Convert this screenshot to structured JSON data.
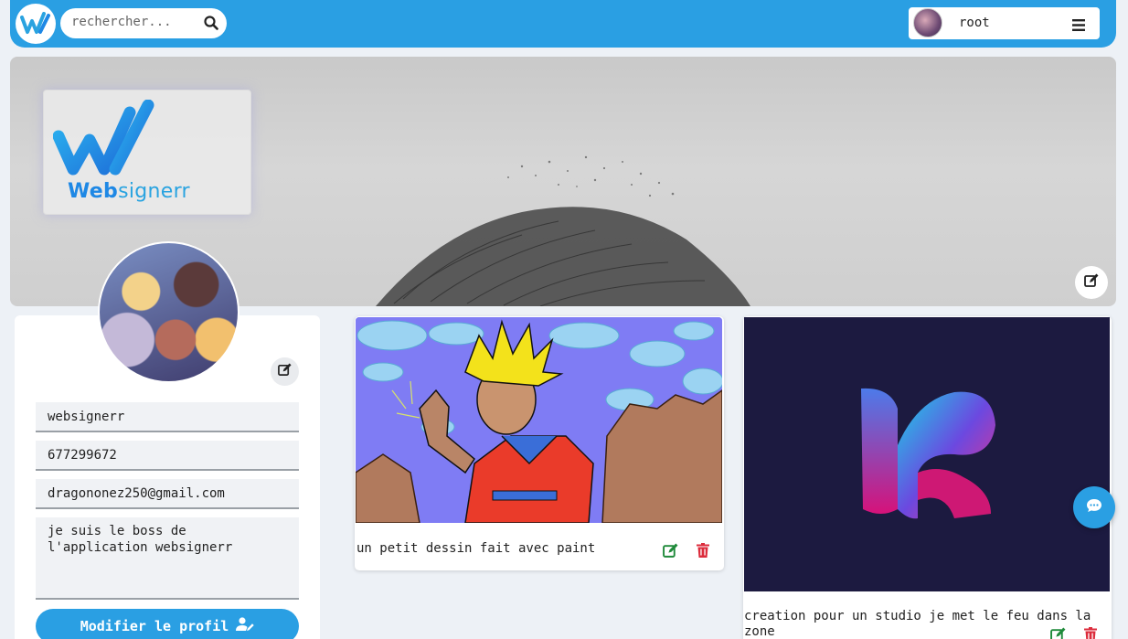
{
  "navbar": {
    "search_placeholder": "rechercher...",
    "user_name": "root",
    "accent": "#2a9fe3"
  },
  "cover": {
    "logo_text_bold": "Web",
    "logo_text_light": "signerr"
  },
  "profile": {
    "username": "websignerr",
    "phone": "677299672",
    "email": "dragononez250@gmail.com",
    "bio": "je suis le boss de l'application websignerr",
    "modify_label": "Modifier le profil"
  },
  "posts": [
    {
      "caption": "un petit dessin fait avec paint"
    },
    {
      "caption": "creation pour un studio je met le feu dans la zone"
    }
  ],
  "icons": {
    "search": "search-icon",
    "menu": "hamburger-menu-icon",
    "edit": "edit-icon",
    "delete": "trash-icon",
    "chat": "chat-icon",
    "user_edit": "user-edit-icon"
  }
}
